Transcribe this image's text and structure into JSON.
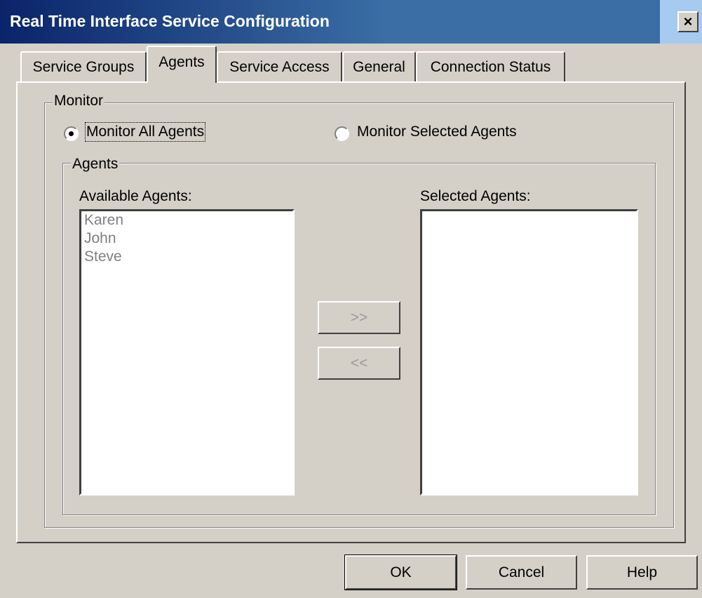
{
  "window": {
    "title": "Real Time Interface Service Configuration",
    "close_glyph": "×"
  },
  "tabs": [
    {
      "label": "Service Groups"
    },
    {
      "label": "Agents",
      "selected": true
    },
    {
      "label": "Service Access"
    },
    {
      "label": "General"
    },
    {
      "label": "Connection Status"
    }
  ],
  "monitor": {
    "group_label": "Monitor",
    "option_all": {
      "label": "Monitor All Agents",
      "checked": true
    },
    "option_selected": {
      "label": "Monitor Selected Agents",
      "checked": false
    }
  },
  "agents": {
    "group_label": "Agents",
    "available_label": "Available Agents:",
    "selected_label": "Selected Agents:",
    "available_items": [
      "Karen",
      "John",
      "Steve"
    ],
    "selected_items": [],
    "add_button": ">>",
    "remove_button": "<<"
  },
  "buttons": {
    "ok": "OK",
    "cancel": "Cancel",
    "help": "Help"
  },
  "colors": {
    "face": "#d4d0c8",
    "title_start": "#0a246a",
    "title_end": "#3a6ea5",
    "disabled_text": "#808080"
  }
}
